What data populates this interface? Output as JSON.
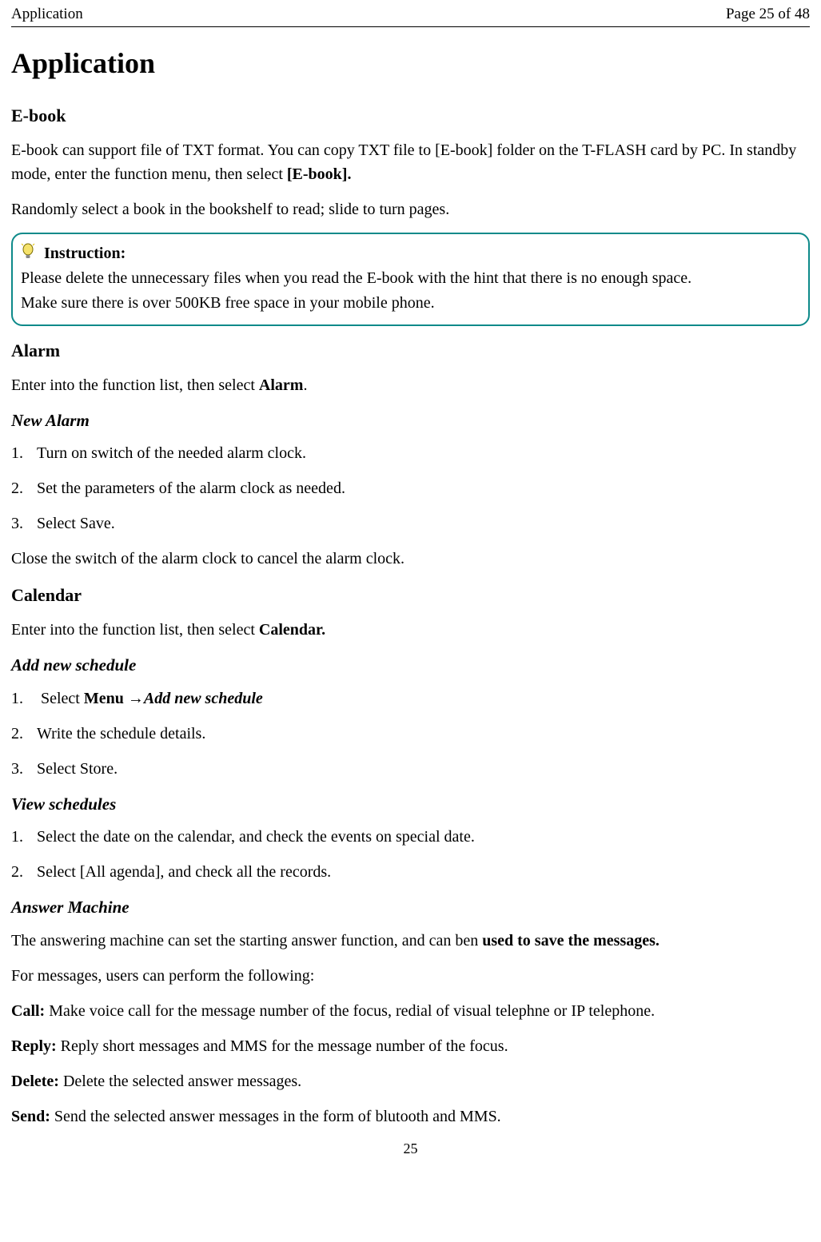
{
  "header": {
    "left": "Application",
    "right": "Page 25 of 48"
  },
  "title": "Application",
  "ebook": {
    "heading": "E-book",
    "p1_a": "E-book can support file of TXT format. You can copy TXT file to [E-book] folder on the T-FLASH card by PC. In standby mode, enter the function menu, then select ",
    "p1_b_bold": "[E-book].",
    "p2": "Randomly select a book in the bookshelf to read; slide to turn pages."
  },
  "instruction": {
    "label": "Instruction:",
    "line1": "Please delete the unnecessary files when you read the E-book with the hint that there is no enough space.",
    "line2": "Make sure there is over 500KB free space in your mobile phone."
  },
  "alarm": {
    "heading": "Alarm",
    "intro_a": "Enter into the function list, then select ",
    "intro_b_bold": "Alarm",
    "intro_c": ".",
    "sub_new": "New Alarm",
    "steps": [
      "Turn on switch of the needed alarm clock.",
      "Set the parameters of the alarm clock as needed.",
      "Select Save."
    ],
    "close": "Close the switch of the alarm clock to cancel the alarm clock."
  },
  "calendar": {
    "heading": "Calendar",
    "intro_a": "Enter into the function list, then select ",
    "intro_b_bold": "Calendar.",
    "sub_add": "Add new schedule",
    "add_steps_prefix": "Select ",
    "add_steps_bold": "Menu →",
    "add_steps_bi": "Add new schedule",
    "add_step2": "Write the schedule details.",
    "add_step3": "Select Store.",
    "sub_view": "View schedules",
    "view_step1": "Select the date on the calendar, and check the events on special date.",
    "view_step2": "Select [All agenda], and check all the records."
  },
  "answer": {
    "heading": "Answer Machine",
    "p1_a": "The answering machine can set the starting answer function, and can ben ",
    "p1_b_bold": "used to save the messages.",
    "p2": "For messages, users can perform the following:",
    "call_label": "Call:",
    "call_text": " Make voice call for the message number of the focus, redial of visual telephne or IP telephone.",
    "reply_label": "Reply:",
    "reply_text": " Reply short messages and MMS for the message number of the focus.",
    "delete_label": "Delete:",
    "delete_text": " Delete the selected answer messages.",
    "send_label": "Send:",
    "send_text": " Send the selected answer messages in the form of blutooth and MMS."
  },
  "footer_pagenum": "25"
}
